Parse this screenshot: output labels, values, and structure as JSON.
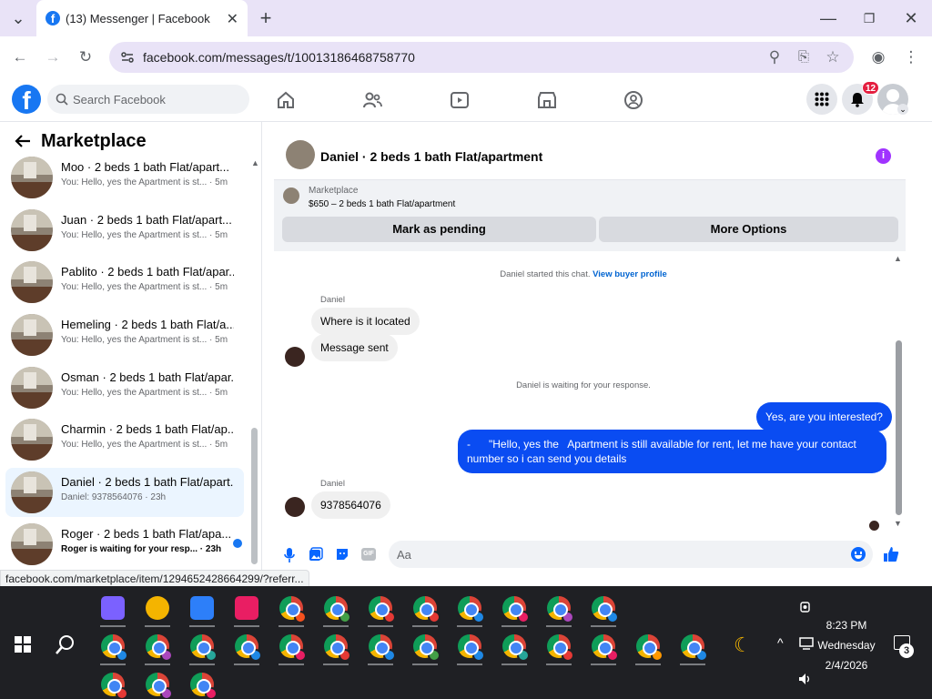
{
  "browser": {
    "tab_title": "(13) Messenger | Facebook",
    "url": "facebook.com/messages/t/10013186468758770"
  },
  "fb": {
    "search_placeholder": "Search Facebook",
    "notif_count": "12"
  },
  "left": {
    "title": "Marketplace",
    "conversations": [
      {
        "name": "Moo · 2 beds 1 bath Flat/apart...",
        "preview": "You: Hello, yes the Apartment is st... · 5m"
      },
      {
        "name": "Juan · 2 beds 1 bath Flat/apart...",
        "preview": "You: Hello, yes the Apartment is st... · 5m"
      },
      {
        "name": "Pablito · 2 beds 1 bath Flat/apar...",
        "preview": "You: Hello, yes the Apartment is st... · 5m"
      },
      {
        "name": "Hemeling · 2 beds 1 bath Flat/a...",
        "preview": "You: Hello, yes the Apartment is st... · 5m"
      },
      {
        "name": "Osman · 2 beds 1 bath Flat/apar...",
        "preview": "You: Hello, yes the Apartment is st... · 5m"
      },
      {
        "name": "Charmin · 2 beds 1 bath Flat/ap...",
        "preview": "You: Hello, yes the Apartment is st... · 5m"
      },
      {
        "name": "Daniel · 2 beds 1 bath Flat/apart...",
        "preview": "Daniel: 9378564076 · 23h"
      },
      {
        "name": "Roger · 2 beds 1 bath Flat/apa...",
        "preview": "Roger is waiting for your resp... · 23h"
      }
    ]
  },
  "chat": {
    "title": "Daniel · 2 beds 1 bath Flat/apartment",
    "card_label": "Marketplace",
    "card_price": "$650 – 2 beds 1 bath Flat/apartment",
    "btn_pending": "Mark as pending",
    "btn_more": "More Options",
    "started": "Daniel started this chat.",
    "buyer_profile": "View buyer profile",
    "sender": "Daniel",
    "msg1": "Where is it located",
    "msg2": "Message sent",
    "waiting": "Daniel is waiting for your response.",
    "out1": "Yes, are you interested?",
    "out2": "-      \"Hello, yes the   Apartment is still available for rent, let me have your contact number so i can send you details",
    "msg3": "9378564076",
    "composer_placeholder": "Aa"
  },
  "status_url": "facebook.com/marketplace/item/1294652428664299/?referr...",
  "clock": {
    "time": "8:23 PM",
    "day": "Wednesday",
    "date": "2/4/2026"
  },
  "tray_notifications": "3",
  "taskbar_colors": {
    "row1": [
      "#7b61ff",
      "#f4b400",
      "#2d7ff9",
      "#e91e63",
      "#f4511e",
      "#43a047",
      "#e53935",
      "#e53935",
      "#1e88e5",
      "#e91e63",
      "#ab47bc",
      "#1e88e5"
    ],
    "row2": [
      "#1e88e5",
      "#ab47bc",
      "#26a69a",
      "#1e88e5",
      "#e91e63",
      "#e53935",
      "#1e88e5",
      "#43a047",
      "#1e88e5",
      "#26a69a",
      "#e53935",
      "#e91e63",
      "#ff9800",
      "#1e88e5"
    ],
    "row3": [
      "#e53935",
      "#ab47bc",
      "#e91e63"
    ]
  }
}
